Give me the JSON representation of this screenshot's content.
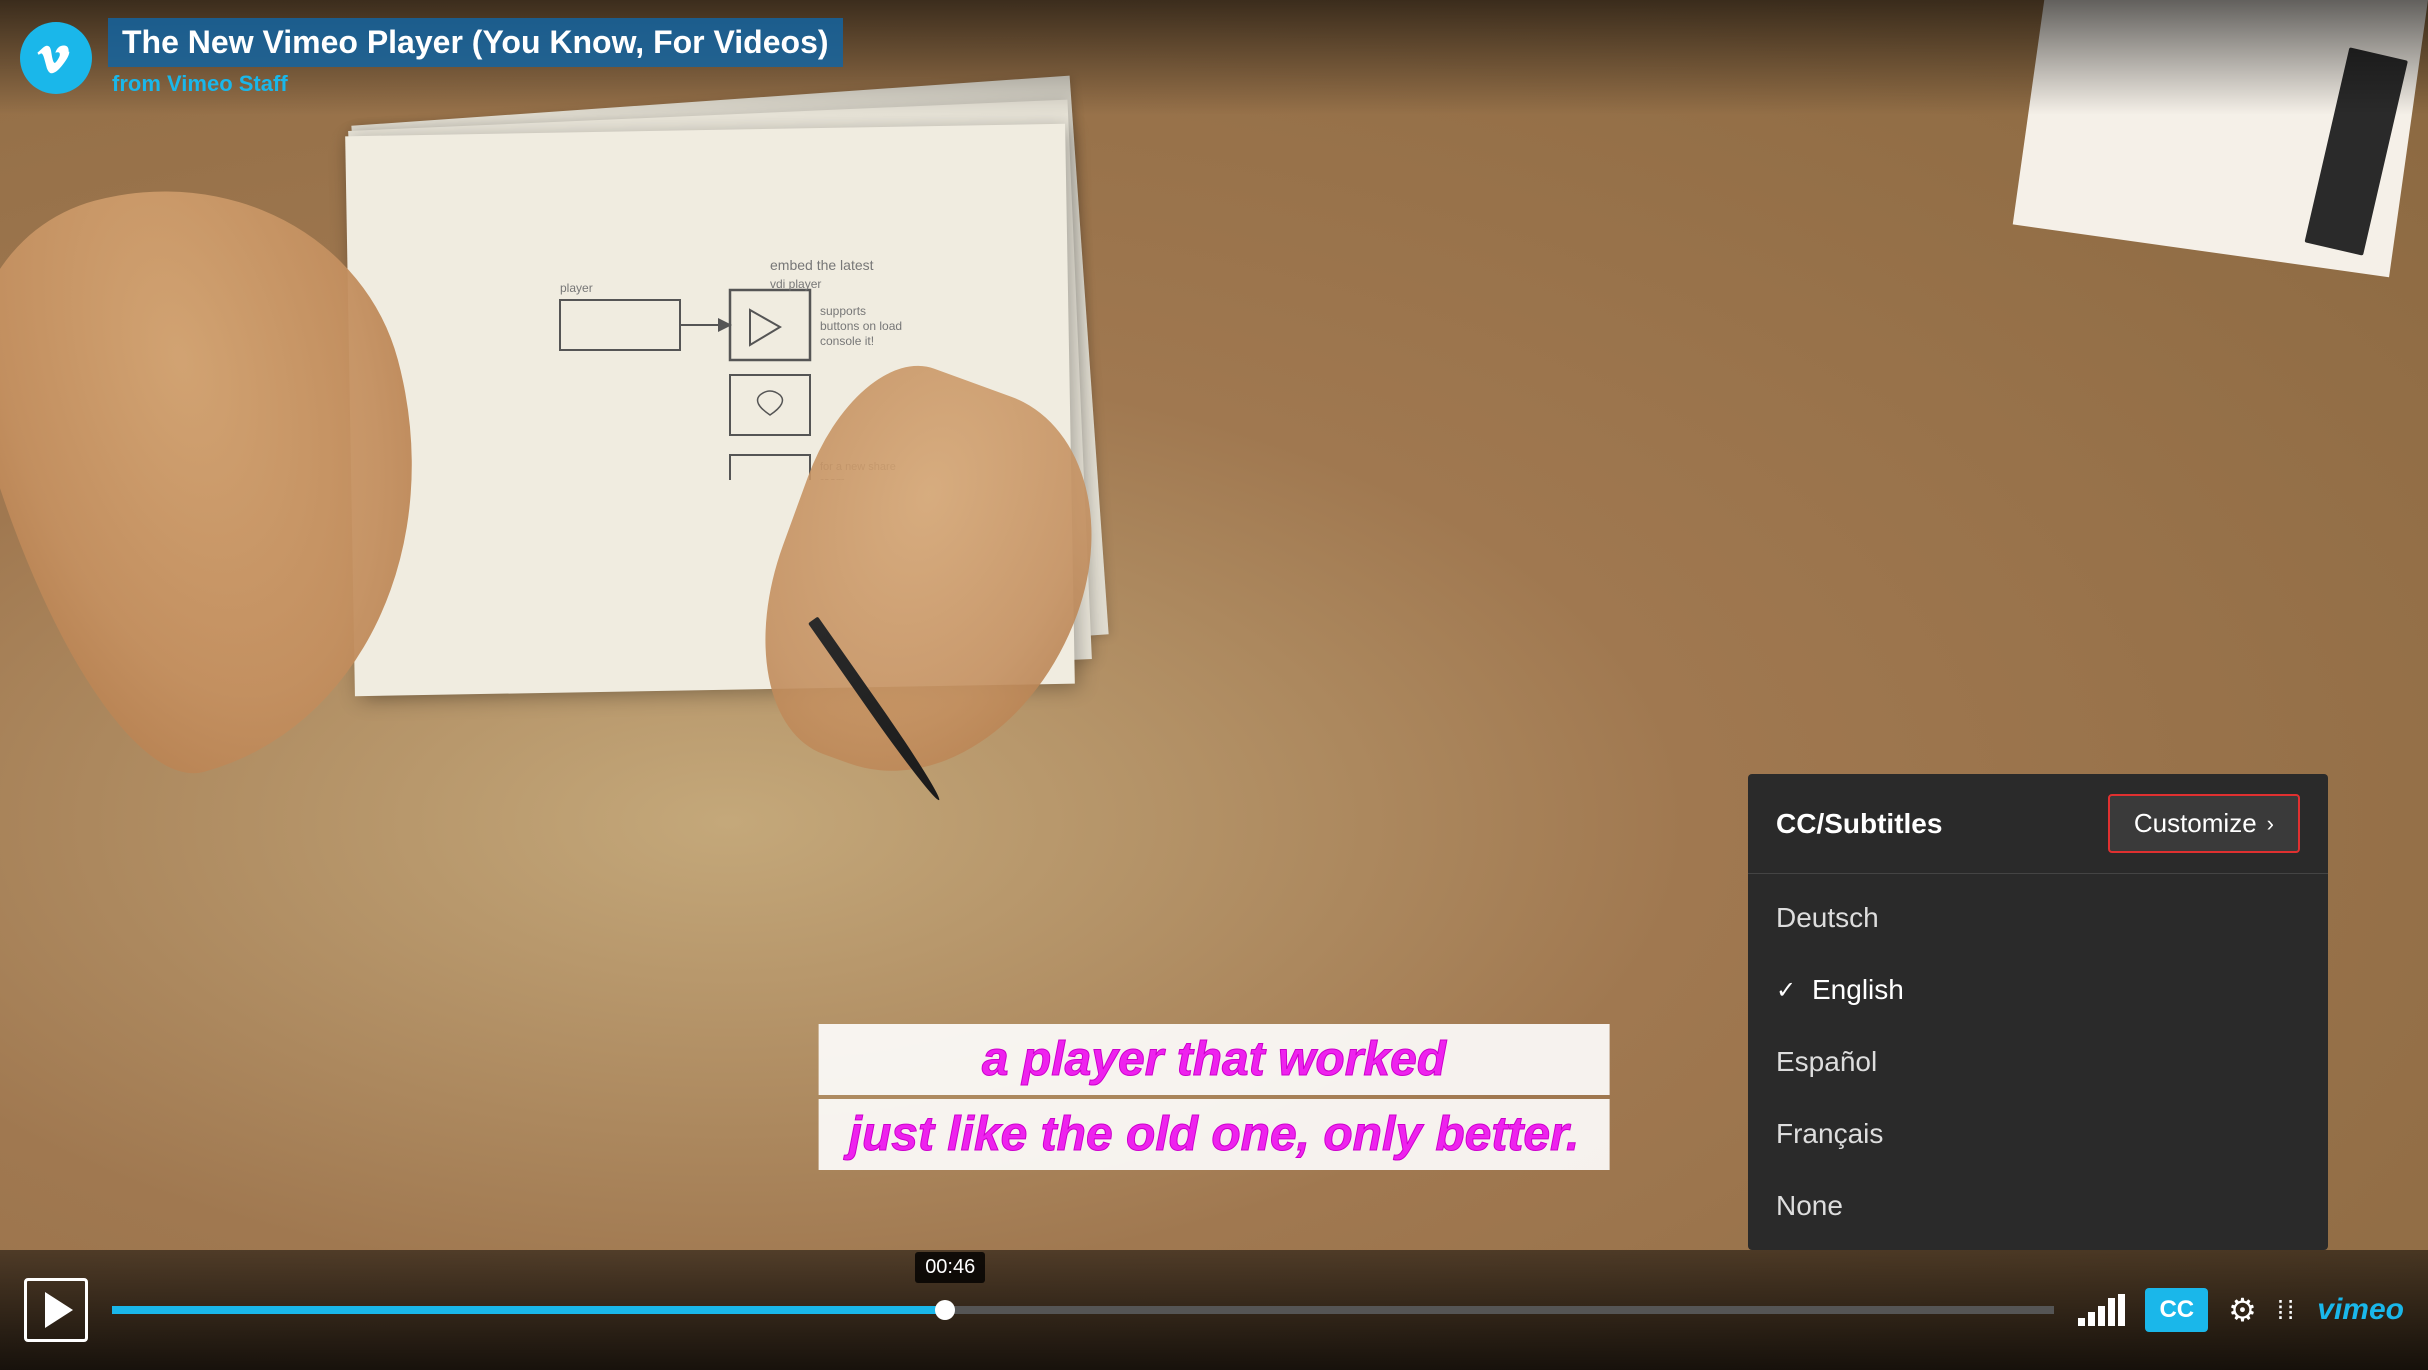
{
  "player": {
    "title": "The New Vimeo Player (You Know, For Videos)",
    "from_label": "from",
    "author": "Vimeo Staff",
    "time_tooltip": "00:46"
  },
  "subtitle": {
    "line1": "a player that worked",
    "line2": "just like the old one, only better."
  },
  "cc_menu": {
    "title": "CC/Subtitles",
    "customize_label": "Customize",
    "items": [
      {
        "label": "Deutsch",
        "selected": false
      },
      {
        "label": "English",
        "selected": true
      },
      {
        "label": "Español",
        "selected": false
      },
      {
        "label": "Français",
        "selected": false
      },
      {
        "label": "None",
        "selected": false
      }
    ]
  },
  "controls": {
    "play_label": "Play",
    "cc_label": "CC",
    "vimeo_label": "vimeo",
    "progress_percent": 43
  },
  "icons": {
    "play": "▶",
    "settings": "⚙",
    "fullscreen": "⁞⁞",
    "chevron_right": "›",
    "checkmark": "✓"
  }
}
